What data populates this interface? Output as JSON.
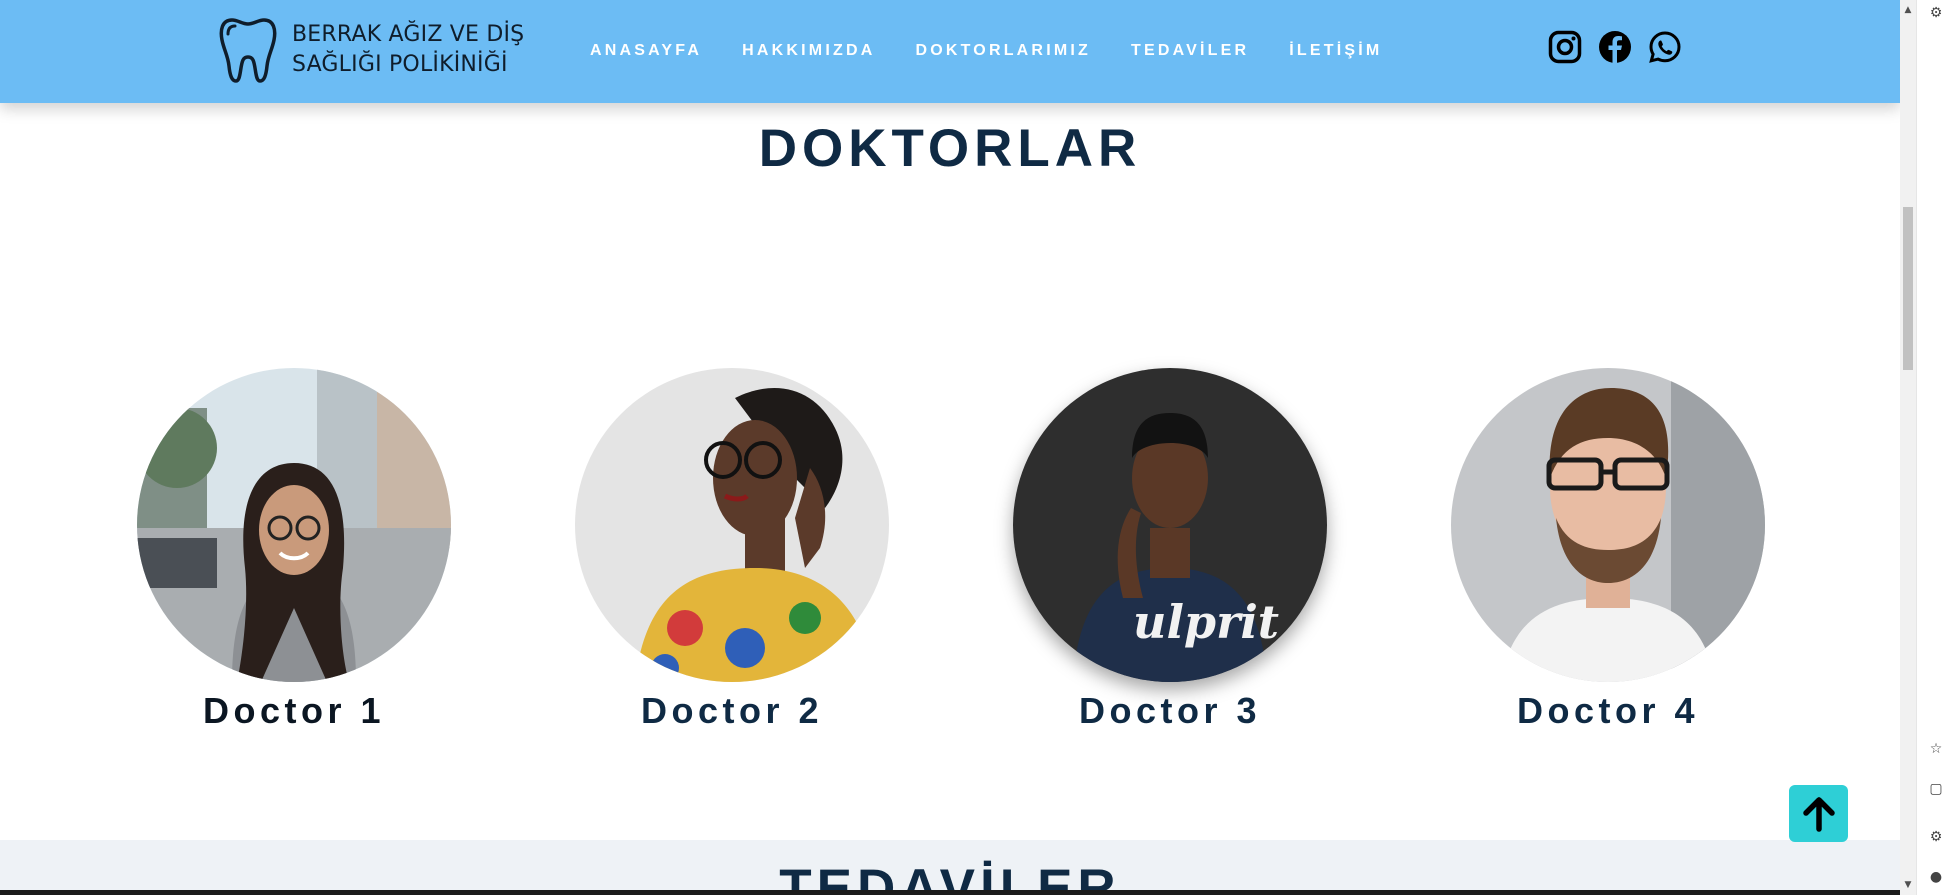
{
  "header": {
    "logo_line1": "BERRAK AĞIZ VE DİŞ",
    "logo_line2": "SAĞLIĞI POLİKİNİĞİ",
    "nav": [
      {
        "label": "ANASAYFA"
      },
      {
        "label": "HAKKIMIZDA"
      },
      {
        "label": "DOKTORLARIMIZ"
      },
      {
        "label": "TEDAVİLER"
      },
      {
        "label": "İLETİŞİM"
      }
    ],
    "social_icons": [
      "instagram-icon",
      "facebook-icon",
      "whatsapp-icon"
    ],
    "bg_color": "#6cbcf4"
  },
  "doctors_section": {
    "title": "DOKTORLAR",
    "doctors": [
      {
        "name": "Doctor 1"
      },
      {
        "name": "Doctor 2"
      },
      {
        "name": "Doctor 3"
      },
      {
        "name": "Doctor 4"
      }
    ]
  },
  "treatments_section": {
    "title": "TEDAVİLER"
  },
  "back_to_top": {
    "icon": "arrow-up-icon",
    "color": "#2ecfd6"
  },
  "colors": {
    "heading": "#0f2a44",
    "accent": "#2ecfd6"
  }
}
